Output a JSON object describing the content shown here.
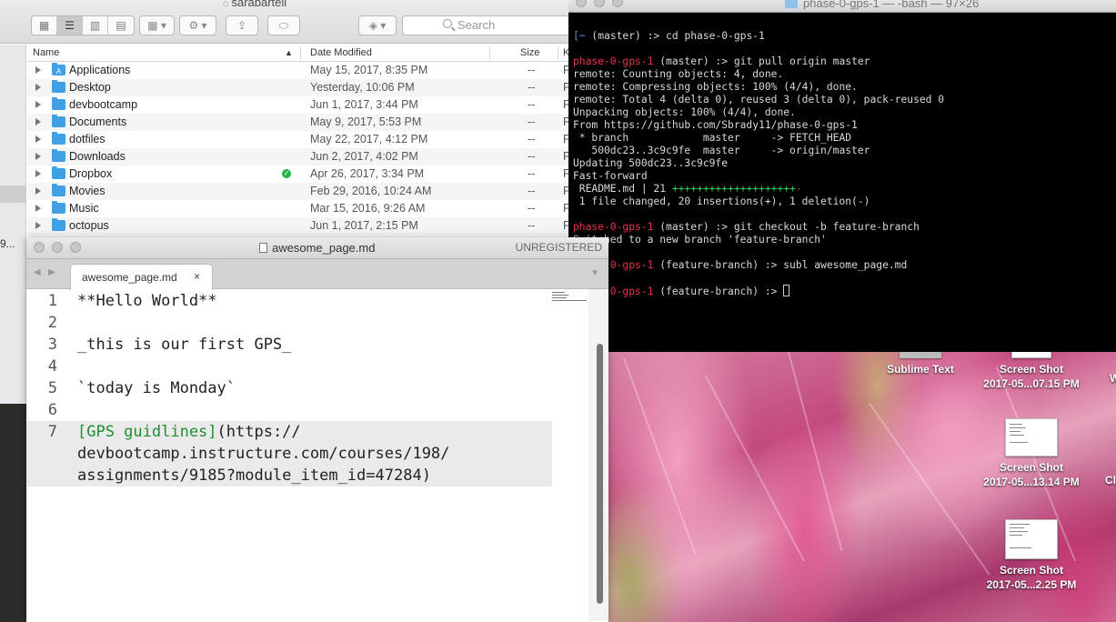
{
  "finder": {
    "title": "sarabartell",
    "search_placeholder": "Search",
    "columns": {
      "name": "Name",
      "date": "Date Modified",
      "size": "Size",
      "kind": "K"
    },
    "sidebar_fragments": [
      "9...",
      "9..."
    ],
    "rows": [
      {
        "name": "Applications",
        "date": "May 15, 2017, 8:35 PM",
        "size": "--",
        "kind": "F",
        "icon": "A"
      },
      {
        "name": "Desktop",
        "date": "Yesterday, 10:06 PM",
        "size": "--",
        "kind": "F",
        "icon": ""
      },
      {
        "name": "devbootcamp",
        "date": "Jun 1, 2017, 3:44 PM",
        "size": "--",
        "kind": "F",
        "icon": ""
      },
      {
        "name": "Documents",
        "date": "May 9, 2017, 5:53 PM",
        "size": "--",
        "kind": "F",
        "icon": ""
      },
      {
        "name": "dotfiles",
        "date": "May 22, 2017, 4:12 PM",
        "size": "--",
        "kind": "F",
        "icon": ""
      },
      {
        "name": "Downloads",
        "date": "Jun 2, 2017, 4:02 PM",
        "size": "--",
        "kind": "F",
        "icon": ""
      },
      {
        "name": "Dropbox",
        "date": "Apr 26, 2017, 3:34 PM",
        "size": "--",
        "kind": "F",
        "icon": ""
      },
      {
        "name": "Movies",
        "date": "Feb 29, 2016, 10:24 AM",
        "size": "--",
        "kind": "F",
        "icon": ""
      },
      {
        "name": "Music",
        "date": "Mar 15, 2016, 9:26 AM",
        "size": "--",
        "kind": "F",
        "icon": ""
      },
      {
        "name": "octopus",
        "date": "Jun 1, 2017, 2:15 PM",
        "size": "--",
        "kind": "F",
        "icon": ""
      }
    ]
  },
  "sublime": {
    "window_title": "awesome_page.md",
    "unregistered": "UNREGISTERED",
    "tab_label": "awesome_page.md",
    "tab_close": "×",
    "lines": [
      {
        "num": "1",
        "text": "**Hello World**"
      },
      {
        "num": "2",
        "text": ""
      },
      {
        "num": "3",
        "text": "_this is our first GPS_"
      },
      {
        "num": "4",
        "text": ""
      },
      {
        "num": "5",
        "text": "`today is Monday`"
      },
      {
        "num": "6",
        "text": ""
      },
      {
        "num": "7",
        "link_text": "[GPS guidlines]",
        "url_part1": "(https://",
        "url_part2": "devbootcamp.instructure.com/courses/198/",
        "url_part3": "assignments/9185?module_item_id=47284)"
      }
    ]
  },
  "terminal": {
    "title": "phase-0-gps-1 — -bash — 97×26",
    "prompt_home": "~",
    "prompt_repo": "phase-0-gps-1",
    "line1_rest": " (master) :> cd phase-0-gps-1",
    "line2_rest": " (master) :> git pull origin master",
    "out": [
      "remote: Counting objects: 4, done.",
      "remote: Compressing objects: 100% (4/4), done.",
      "remote: Total 4 (delta 0), reused 3 (delta 0), pack-reused 0",
      "Unpacking objects: 100% (4/4), done.",
      "From https://github.com/Sbrady11/phase-0-gps-1",
      " * branch            master     -> FETCH_HEAD",
      "   500dc23..3c9c9fe  master     -> origin/master",
      "Updating 500dc23..3c9c9fe",
      "Fast-forward"
    ],
    "readme_line": " README.md | 21 ",
    "readme_plus": "++++++++++++++++++++",
    "readme_minus": "-",
    "changed_line": " 1 file changed, 20 insertions(+), 1 deletion(-)",
    "line3_rest": " (master) :> git checkout -b feature-branch",
    "switched": "Switched to a new branch 'feature-branch'",
    "line4_rest": " (feature-branch) :> subl awesome_page.md",
    "line5_rest": " (feature-branch) :> "
  },
  "desktop": {
    "icons": [
      {
        "label1": "Sublime Text",
        "label2": ""
      },
      {
        "label1": "Screen Shot",
        "label2": "2017-05...07.15 PM"
      },
      {
        "label1": "Screen Shot",
        "label2": "2017-05...13.14 PM"
      },
      {
        "label1": "Screen Shot",
        "label2": "2017-05...2.25 PM"
      }
    ],
    "edge_fragments": [
      "W",
      "Cl"
    ]
  }
}
